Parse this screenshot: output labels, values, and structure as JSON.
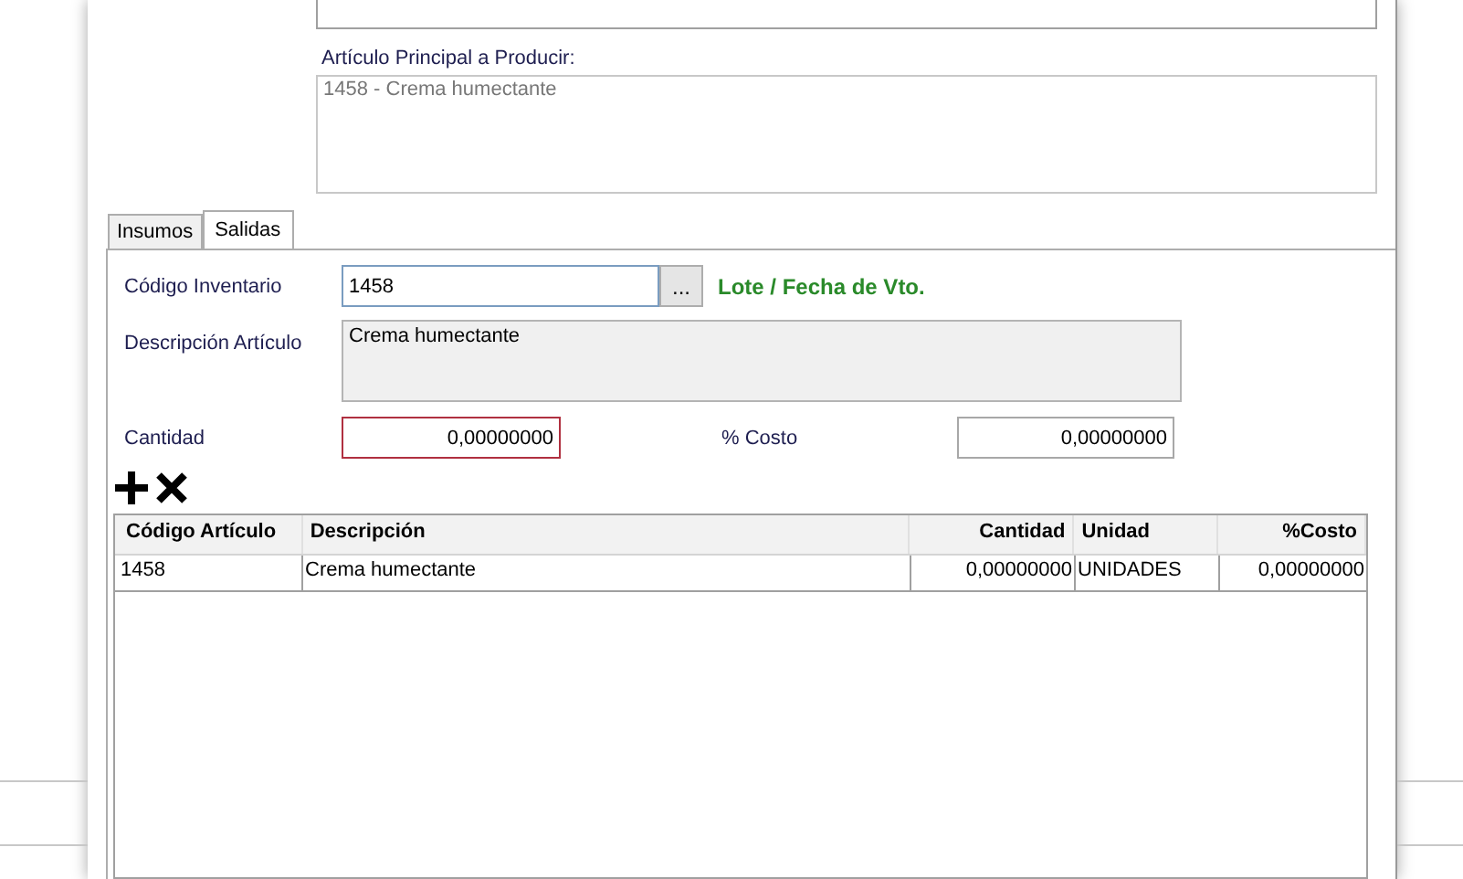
{
  "principal": {
    "label": "Artículo Principal a Producir:",
    "value": "1458 - Crema humectante"
  },
  "tabs": [
    {
      "label": "Insumos",
      "selected": false
    },
    {
      "label": "Salidas",
      "selected": true
    }
  ],
  "form": {
    "codigo_label": "Código Inventario",
    "codigo_value": "1458",
    "browse_button": "...",
    "lote_link": "Lote / Fecha de Vto.",
    "descripcion_label": "Descripción Artículo",
    "descripcion_value": "Crema humectante",
    "cantidad_label": "Cantidad",
    "cantidad_value": "0,00000000",
    "cantidad_error": true,
    "costo_label": "% Costo",
    "costo_value": "0,00000000"
  },
  "actions": [
    {
      "kind": "add"
    },
    {
      "kind": "remove"
    }
  ],
  "table": {
    "columns": [
      {
        "label": "Código Artículo",
        "kind": "text"
      },
      {
        "label": "Descripción",
        "kind": "text"
      },
      {
        "label": "Cantidad",
        "kind": "number"
      },
      {
        "label": "Unidad",
        "kind": "text"
      },
      {
        "label": "%Costo",
        "kind": "number"
      }
    ],
    "rows": [
      [
        "1458",
        "Crema humectante",
        "0,00000000",
        "UNIDADES",
        "0,00000000"
      ]
    ]
  }
}
